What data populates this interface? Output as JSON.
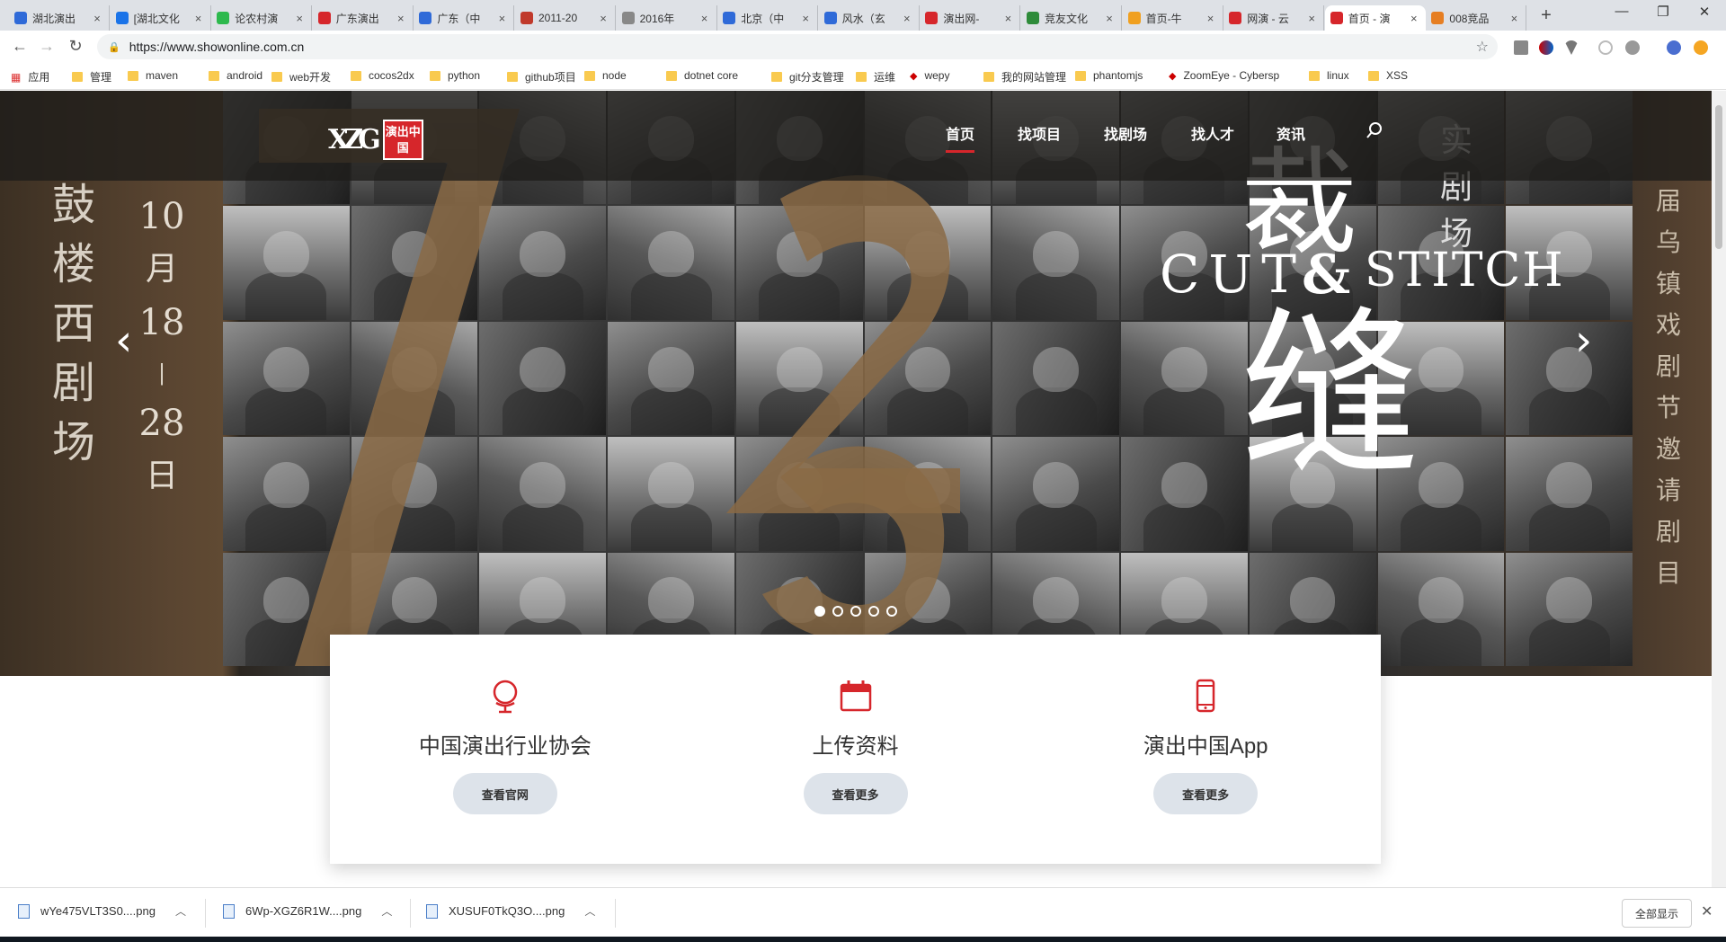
{
  "browser": {
    "tabs": [
      {
        "title": "湖北演出",
        "icon_color": "#2f6ad8",
        "icon": "baidu-paw-icon"
      },
      {
        "title": "[湖北文化",
        "icon_color": "#1a73e8",
        "icon": "dot-icon"
      },
      {
        "title": "论农村演",
        "icon_color": "#2db94d",
        "icon": "iq-icon"
      },
      {
        "title": "广东演出",
        "icon_color": "#d6262b",
        "icon": "weibo-icon"
      },
      {
        "title": "广东（中",
        "icon_color": "#2f6ad8",
        "icon": "baidu-paw-icon"
      },
      {
        "title": "2011-20",
        "icon_color": "#c0392b",
        "icon": "globe-icon"
      },
      {
        "title": "2016年",
        "icon_color": "#888888",
        "icon": "document-icon"
      },
      {
        "title": "北京（中",
        "icon_color": "#2f6ad8",
        "icon": "baidu-paw-icon"
      },
      {
        "title": "风水（玄",
        "icon_color": "#2f6ad8",
        "icon": "baidu-paw-icon"
      },
      {
        "title": "演出网-",
        "icon_color": "#d6262b",
        "icon": "yan-icon"
      },
      {
        "title": "竞友文化",
        "icon_color": "#2e8b3a",
        "icon": "douban-icon"
      },
      {
        "title": "首页-牛",
        "icon_color": "#f0a020",
        "icon": "bookmark-icon"
      },
      {
        "title": "网演 - 云",
        "icon_color": "#d6262b",
        "icon": "flag-icon"
      },
      {
        "title": "首页 - 演",
        "icon_color": "#d6262b",
        "icon": "showonline-icon"
      },
      {
        "title": "008竞品",
        "icon_color": "#e67e22",
        "icon": "fox-icon"
      }
    ],
    "active_tab": 13,
    "new_tab_label": "+",
    "window_controls": {
      "minimize": "—",
      "maximize": "❐",
      "close": "✕"
    },
    "url": "https://www.showonline.com.cn",
    "bookmarks": [
      {
        "label": "应用",
        "type": "apps"
      },
      {
        "label": "管理",
        "type": "folder"
      },
      {
        "label": "maven",
        "type": "folder"
      },
      {
        "label": "android",
        "type": "folder"
      },
      {
        "label": "web开发",
        "type": "folder"
      },
      {
        "label": "cocos2dx",
        "type": "folder"
      },
      {
        "label": "python",
        "type": "folder"
      },
      {
        "label": "github项目",
        "type": "folder"
      },
      {
        "label": "node",
        "type": "folder"
      },
      {
        "label": "dotnet core",
        "type": "folder"
      },
      {
        "label": "git分支管理",
        "type": "folder"
      },
      {
        "label": "运维",
        "type": "folder"
      },
      {
        "label": "wepy",
        "type": "site"
      },
      {
        "label": "我的网站管理",
        "type": "folder"
      },
      {
        "label": "phantomjs",
        "type": "folder"
      },
      {
        "label": "ZoomEye - Cybersp",
        "type": "site"
      },
      {
        "label": "linux",
        "type": "folder"
      },
      {
        "label": "XSS",
        "type": "folder"
      }
    ]
  },
  "site": {
    "nav": [
      {
        "label": "首页",
        "active": true
      },
      {
        "label": "找项目",
        "active": false
      },
      {
        "label": "找剧场",
        "active": false
      },
      {
        "label": "找人才",
        "active": false
      },
      {
        "label": "资讯",
        "active": false
      }
    ],
    "logo_seal": "演出中国",
    "hero": {
      "left_venue": [
        "鼓",
        "楼",
        "西",
        "剧",
        "场"
      ],
      "date": {
        "month": "10",
        "month_unit": "月",
        "start": "18",
        "dash": "|",
        "end": "28",
        "day_unit": "日"
      },
      "right_vertical": [
        "届",
        "乌",
        "镇",
        "戏",
        "剧",
        "节",
        "邀",
        "请",
        "剧",
        "目"
      ],
      "title_cut": "CUT",
      "title_amp": "&",
      "title_stitch": "STITCH",
      "big_char": "缝",
      "top_char": "裁",
      "side_chars": [
        "实",
        "剧",
        "场"
      ],
      "slides": 5,
      "active_slide": 0,
      "accent_color": "#8a6a45"
    },
    "cards": [
      {
        "icon": "globe-stand-icon",
        "title": "中国演出行业协会",
        "button": "查看官网"
      },
      {
        "icon": "calendar-icon",
        "title": "上传资料",
        "button": "查看更多"
      },
      {
        "icon": "mobile-phone-icon",
        "title": "演出中国App",
        "button": "查看更多"
      }
    ],
    "brand_red": "#d6262b"
  },
  "downloads": {
    "items": [
      "wYe475VLT3S0....png",
      "6Wp-XGZ6R1W....png",
      "XUSUF0TkQ3O....png"
    ],
    "show_all": "全部显示",
    "close": "✕"
  }
}
